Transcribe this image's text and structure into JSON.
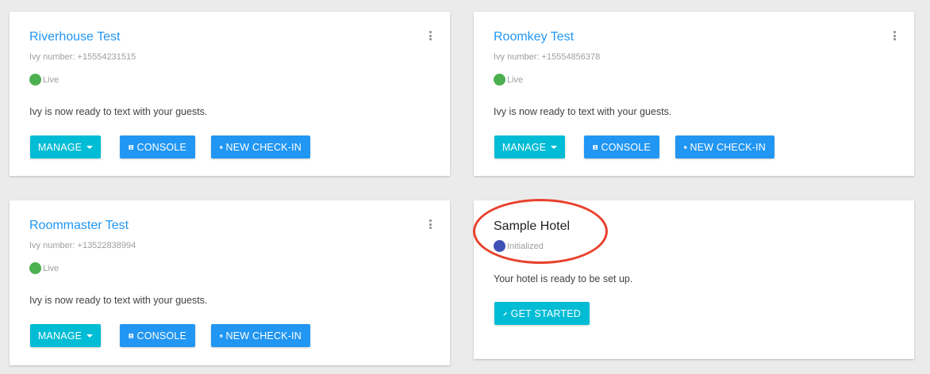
{
  "hotels": [
    {
      "name": "Riverhouse Test",
      "ivy_number": "Ivy number: +15554231515",
      "status": "Live",
      "message": "Ivy is now ready to text with your guests.",
      "buttons": {
        "manage": "MANAGE",
        "console": "CONSOLE",
        "checkin": "NEW CHECK-IN"
      }
    },
    {
      "name": "Roomkey Test",
      "ivy_number": "Ivy number: +15554856378",
      "status": "Live",
      "message": "Ivy is now ready to text with your guests.",
      "buttons": {
        "manage": "MANAGE",
        "console": "CONSOLE",
        "checkin": "NEW CHECK-IN"
      }
    },
    {
      "name": "Roommaster Test",
      "ivy_number": "Ivy number: +13522838994",
      "status": "Live",
      "message": "Ivy is now ready to text with your guests.",
      "buttons": {
        "manage": "MANAGE",
        "console": "CONSOLE",
        "checkin": "NEW CHECK-IN"
      }
    },
    {
      "name": "Sample Hotel",
      "status": "Initialized",
      "message": "Your hotel is ready to be set up.",
      "buttons": {
        "start": "GET STARTED"
      }
    }
  ],
  "colors": {
    "live": "#4caf50",
    "initialized": "#3f51b5",
    "link": "#2196f3",
    "cyan": "#00bcd4",
    "highlight": "#e8412c"
  }
}
